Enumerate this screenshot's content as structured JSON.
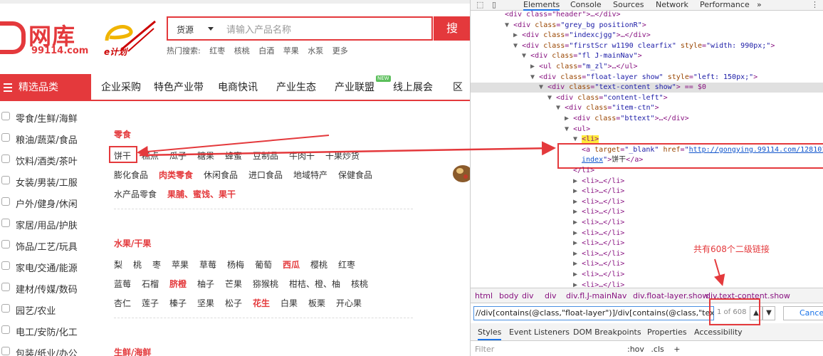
{
  "site": {
    "logo": {
      "brand_cn": "网库",
      "domain": "99114.com",
      "plan": "e计划"
    },
    "search": {
      "category": "货源",
      "placeholder": "请输入产品名称",
      "button": "搜"
    },
    "hot": {
      "label": "热门搜索:",
      "items": [
        "红枣",
        "核桃",
        "白酒",
        "苹果",
        "水泵",
        "更多"
      ]
    },
    "nav": {
      "category_title": "精选品类",
      "items": [
        "企业采购",
        "特色产业带",
        "电商快讯",
        "产业生态",
        "产业联盟",
        "线上展会",
        "区"
      ],
      "new_badge": "NEW"
    },
    "sidebar": [
      "零食/生鲜/海鲜",
      "粮油/蔬菜/食品",
      "饮料/酒类/茶叶",
      "女装/男装/工服",
      "户外/健身/休闲",
      "家居/用品/护肤",
      "饰品/工艺/玩具",
      "家电/交通/能源",
      "建材/传媒/数码",
      "园艺/农业",
      "电工/安防/化工",
      "包装/纸业/办公"
    ],
    "sections": [
      {
        "title": "零食",
        "rows": [
          [
            {
              "t": "饼干"
            },
            {
              "t": "糕点"
            },
            {
              "t": "瓜子"
            },
            {
              "t": "糖果"
            },
            {
              "t": "蜂蜜"
            },
            {
              "t": "豆制品"
            },
            {
              "t": "牛肉干"
            },
            {
              "t": "干果炒货"
            }
          ],
          [
            {
              "t": "膨化食品"
            },
            {
              "t": "肉类零食",
              "red": true
            },
            {
              "t": "休闲食品"
            },
            {
              "t": "进口食品"
            },
            {
              "t": "地域特产"
            },
            {
              "t": "保健食品"
            }
          ],
          [
            {
              "t": "水产品零食"
            },
            {
              "t": "果脯、蜜饯、果干",
              "red": true
            }
          ]
        ]
      },
      {
        "title": "水果/干果",
        "rows": [
          [
            {
              "t": "梨"
            },
            {
              "t": "桃"
            },
            {
              "t": "枣"
            },
            {
              "t": "苹果"
            },
            {
              "t": "草莓"
            },
            {
              "t": "杨梅"
            },
            {
              "t": "葡萄"
            },
            {
              "t": "西瓜",
              "red": true
            },
            {
              "t": "樱桃"
            },
            {
              "t": "红枣"
            }
          ],
          [
            {
              "t": "蓝莓"
            },
            {
              "t": "石榴"
            },
            {
              "t": "脐橙",
              "red": true
            },
            {
              "t": "柚子"
            },
            {
              "t": "芒果"
            },
            {
              "t": "猕猴桃"
            },
            {
              "t": "柑桔、橙、柚"
            },
            {
              "t": "核桃"
            }
          ],
          [
            {
              "t": "杏仁"
            },
            {
              "t": "莲子"
            },
            {
              "t": "榛子"
            },
            {
              "t": "坚果"
            },
            {
              "t": "松子"
            },
            {
              "t": "花生",
              "red": true
            },
            {
              "t": "白果"
            },
            {
              "t": "板栗"
            },
            {
              "t": "开心果"
            }
          ]
        ]
      },
      {
        "title": "生鲜/海鲜",
        "rows": []
      }
    ]
  },
  "devtools": {
    "tabs": [
      "Elements",
      "Console",
      "Sources",
      "Network",
      "Performance",
      "»"
    ],
    "dom": [
      {
        "indent": 2,
        "tri": "",
        "html": "<div class=\"header\">…</div>"
      },
      {
        "indent": 2,
        "tri": "▼",
        "tag": "div",
        "cls": "grey_bg positionR",
        "style": "",
        "end": ">"
      },
      {
        "indent": 3,
        "tri": "▶",
        "tag": "div",
        "cls": "indexcjgg",
        "style": "",
        "end": ">…</div>"
      },
      {
        "indent": 3,
        "tri": "▼",
        "tag": "div",
        "cls": "firstScr w1190 clearfix",
        "style": "width: 990px;",
        "end": ">"
      },
      {
        "indent": 4,
        "tri": "▼",
        "tag": "div",
        "cls": "fl J-mainNav",
        "style": "",
        "end": ">"
      },
      {
        "indent": 5,
        "tri": "▶",
        "tag": "ul",
        "cls": "m_zl",
        "style": "",
        "end": ">…</ul>"
      },
      {
        "indent": 5,
        "tri": "▼",
        "tag": "div",
        "cls": "float-layer show",
        "style": "left: 150px;",
        "end": ">"
      },
      {
        "indent": 6,
        "tri": "▼",
        "tag": "div",
        "cls": "text-content show",
        "style": "",
        "end": "> == $0",
        "selected": true
      },
      {
        "indent": 7,
        "tri": "▼",
        "tag": "div",
        "cls": "content-left",
        "style": "",
        "end": ">"
      },
      {
        "indent": 8,
        "tri": "▼",
        "tag": "div",
        "cls": "item-ctn",
        "style": "",
        "end": ">"
      },
      {
        "indent": 9,
        "tri": "▶",
        "tag": "div",
        "cls": "bttext",
        "style": "",
        "end": ">…</div>"
      },
      {
        "indent": 9,
        "tri": "▼",
        "raw": "<ul>"
      },
      {
        "indent": 10,
        "tri": "▼",
        "raw": "<li>",
        "li": true
      }
    ],
    "anchor": {
      "open": "<a",
      "target_attr": "target",
      "target_val": "_blank",
      "href_attr": "href",
      "href_val": "http://gongying.99114.com/128101101",
      "href_tail": "index",
      "text": "饼干",
      "close": "</a>"
    },
    "after_anchor": [
      {
        "indent": 10,
        "raw": "</li>"
      },
      {
        "indent": 10,
        "raw": "<li>…</li>"
      },
      {
        "indent": 10,
        "raw": "<li>…</li>"
      },
      {
        "indent": 10,
        "raw": "<li>…</li>"
      },
      {
        "indent": 10,
        "raw": "<li>…</li>"
      },
      {
        "indent": 10,
        "raw": "<li>…</li>"
      },
      {
        "indent": 10,
        "raw": "<li>…</li>"
      },
      {
        "indent": 10,
        "raw": "<li>…</li>"
      },
      {
        "indent": 10,
        "raw": "<li>…</li>"
      },
      {
        "indent": 10,
        "raw": "<li>…</li>"
      },
      {
        "indent": 10,
        "raw": "<li>…</li>"
      },
      {
        "indent": 10,
        "raw": "<li>…</li>"
      },
      {
        "indent": 10,
        "raw": "<li>…</li>"
      },
      {
        "indent": 10,
        "raw": "<li>…</li>"
      }
    ],
    "note": "共有608个二级链接",
    "breadcrumbs": [
      "html",
      "body",
      "div",
      "div",
      "div.fl.J-mainNav",
      "div.float-layer.show",
      "div.text-content.show"
    ],
    "xpath": {
      "value": "//div[contains(@class,\"float-layer\")]/div[contains(@class,\"text-content",
      "count": "1 of 608",
      "cancel": "Cancel"
    },
    "styles_tabs": [
      "Styles",
      "Event Listeners",
      "DOM Breakpoints",
      "Properties",
      "Accessibility"
    ],
    "filter_placeholder": "Filter",
    "hov": ":hov",
    "cls": ".cls",
    "plus": "+"
  },
  "colors": {
    "accent": "#e4393c",
    "selection": "#1a73e8"
  }
}
